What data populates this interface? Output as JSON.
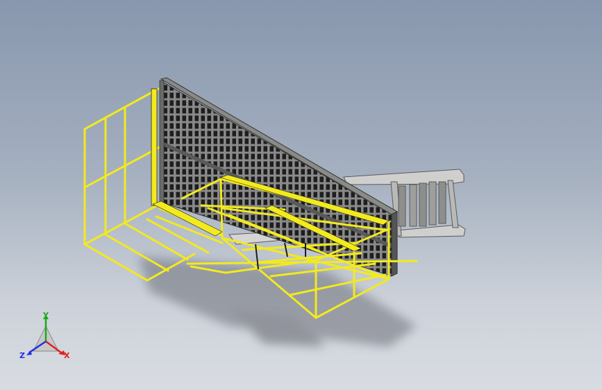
{
  "view": {
    "background_top": "#8897ae",
    "background_bottom": "#d8dce2",
    "frame_color": "#f2ea1e",
    "frame_outline": "#2a2a1a",
    "panel_color": "#6f6f6f",
    "panel_edge": "#3a3a3a",
    "mesh_color": "#222222",
    "ladder_color": "#c9cac8"
  },
  "triad": {
    "x_label": "X",
    "y_label": "Y",
    "z_label": "Z",
    "x_color": "#e02020",
    "y_color": "#1ca81c",
    "z_color": "#2030e0"
  }
}
